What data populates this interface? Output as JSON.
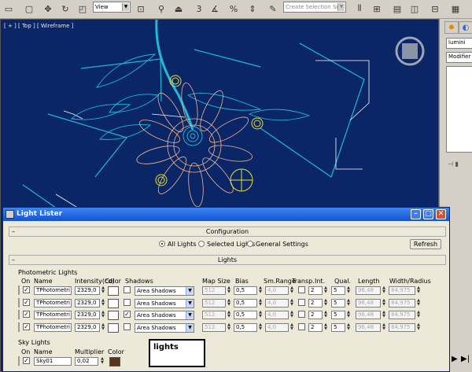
{
  "toolbar": {
    "view_select": "View",
    "selection_set_placeholder": "Create Selection Se",
    "snap_label": "3",
    "icons": [
      "select-region-icon",
      "move-icon",
      "rotate-icon",
      "scale-icon",
      "pivot-icon",
      "align-icon",
      "snap-icon",
      "angle-snap-icon",
      "percent-snap-icon",
      "spinner-snap-icon",
      "named-selection-icon",
      "mirror-icon",
      "align-tool-icon",
      "layer-icon",
      "curve-editor-icon",
      "schematic-icon",
      "material-editor-icon"
    ]
  },
  "viewport": {
    "label": "[ + ] [ Top ] [ Wireframe ]"
  },
  "command_panel": {
    "object_name": "lumini",
    "modifier_list": "Modifier L"
  },
  "dialog": {
    "title": "Light Lister",
    "configuration": {
      "heading": "Configuration",
      "options": [
        "All Lights",
        "Selected Lights",
        "General Settings"
      ],
      "selected": "All Lights",
      "refresh_label": "Refresh"
    },
    "lights": {
      "heading": "Lights",
      "photometric_heading": "Photometric Lights",
      "columns": [
        "On",
        "Name",
        "Intensity(cd)",
        "Color",
        "Shadows",
        "Map Size",
        "Bias",
        "Sm.Range",
        "Transp.",
        "Int.",
        "Qual.",
        "Length",
        "Width/Radius"
      ],
      "rows": [
        {
          "on": true,
          "name": "TPhotometri",
          "intensity": "2329,0",
          "shadow_on": false,
          "shadows": "Area Shadows",
          "map_size": "512",
          "bias": "0,5",
          "sm_range": "4,0",
          "transp": false,
          "int": "2",
          "qual": "5",
          "length": "96,48",
          "width": "84,975"
        },
        {
          "on": true,
          "name": "TPhotometri",
          "intensity": "2329,0",
          "shadow_on": false,
          "shadows": "Area Shadows",
          "map_size": "512",
          "bias": "0,5",
          "sm_range": "4,0",
          "transp": false,
          "int": "2",
          "qual": "5",
          "length": "96,48",
          "width": "84,975"
        },
        {
          "on": true,
          "name": "TPhotometri",
          "intensity": "2329,0",
          "shadow_on": true,
          "shadows": "Area Shadows",
          "map_size": "512",
          "bias": "0,5",
          "sm_range": "4,0",
          "transp": false,
          "int": "2",
          "qual": "5",
          "length": "96,48",
          "width": "84,975"
        },
        {
          "on": true,
          "name": "TPhotometri",
          "intensity": "2329,0",
          "shadow_on": false,
          "shadows": "Area Shadows",
          "map_size": "512",
          "bias": "0,5",
          "sm_range": "4,0",
          "transp": false,
          "int": "2",
          "qual": "5",
          "length": "96,48",
          "width": "84,975"
        }
      ]
    },
    "sky": {
      "heading": "Sky Lights",
      "columns": [
        "On",
        "Name",
        "Multiplier",
        "Color"
      ],
      "row": {
        "on": true,
        "name": "Sky01",
        "multiplier": "0,02",
        "color": "#5a3418"
      }
    }
  },
  "callout": {
    "text": "lights"
  },
  "colors": {
    "viewport_bg": "#0a2666",
    "wire_cyan": "#1fb8d6",
    "wire_peach": "#f5b58e",
    "light_yellow": "#e8e030",
    "titlebar": "#1352d4"
  }
}
